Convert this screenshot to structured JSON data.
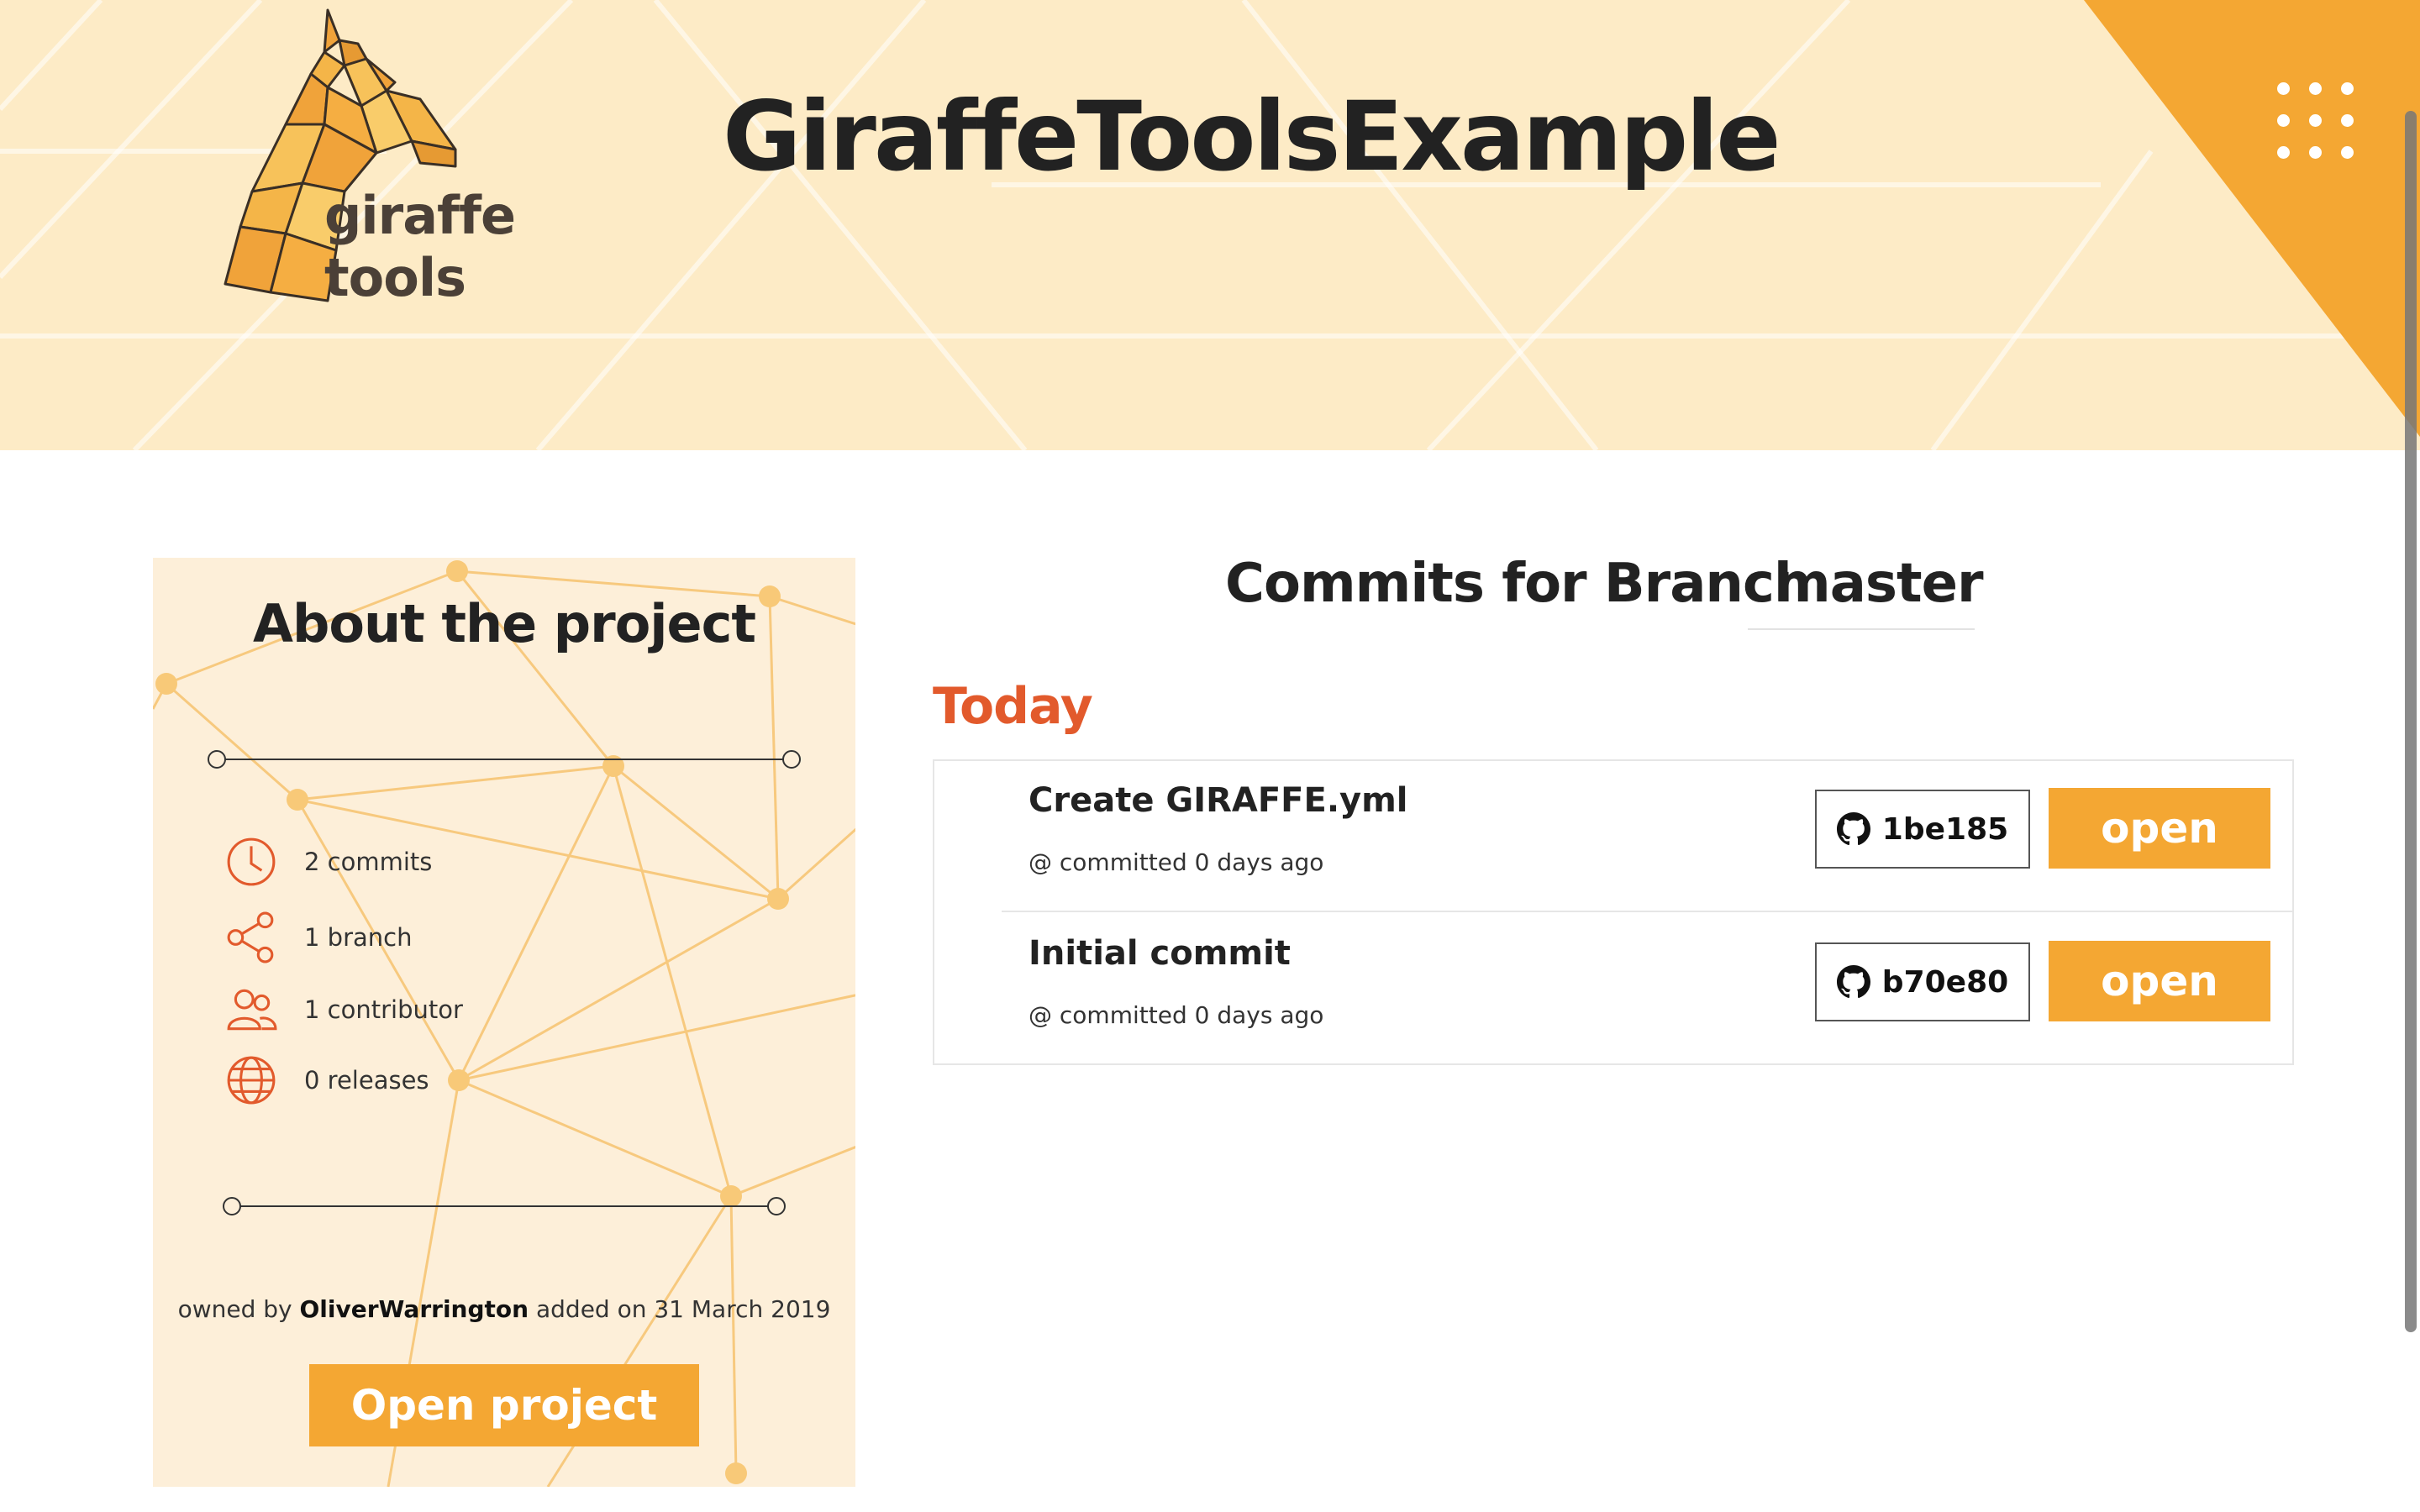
{
  "header": {
    "logo_line1": "giraffe",
    "logo_line2": "tools",
    "title": "GiraffeToolsExample",
    "menu_icon": "grid-dots-icon"
  },
  "about": {
    "title": "About the project",
    "stats": [
      {
        "icon": "clock-icon",
        "label": "2 commits"
      },
      {
        "icon": "share-branch-icon",
        "label": "1 branch"
      },
      {
        "icon": "people-icon",
        "label": "1 contributor"
      },
      {
        "icon": "globe-icon",
        "label": "0 releases"
      }
    ],
    "owned_by_prefix": "owned by",
    "owner": "OliverWarrington",
    "added_on": "added on 31 March 2019",
    "open_project_label": "Open project"
  },
  "commits": {
    "heading": "Commits for Branch",
    "branch": "master",
    "group_label": "Today",
    "items": [
      {
        "message": "Create GIRAFFE.yml",
        "meta": "@ committed 0 days ago",
        "hash": "1be185",
        "open_label": "open"
      },
      {
        "message": "Initial commit",
        "meta": "@ committed 0 days ago",
        "hash": "b70e80",
        "open_label": "open"
      }
    ]
  },
  "colors": {
    "accent": "#f4a733",
    "header_bg": "#fdebc6",
    "today_red": "#e25a2c",
    "card_bg": "#fdefd9"
  }
}
